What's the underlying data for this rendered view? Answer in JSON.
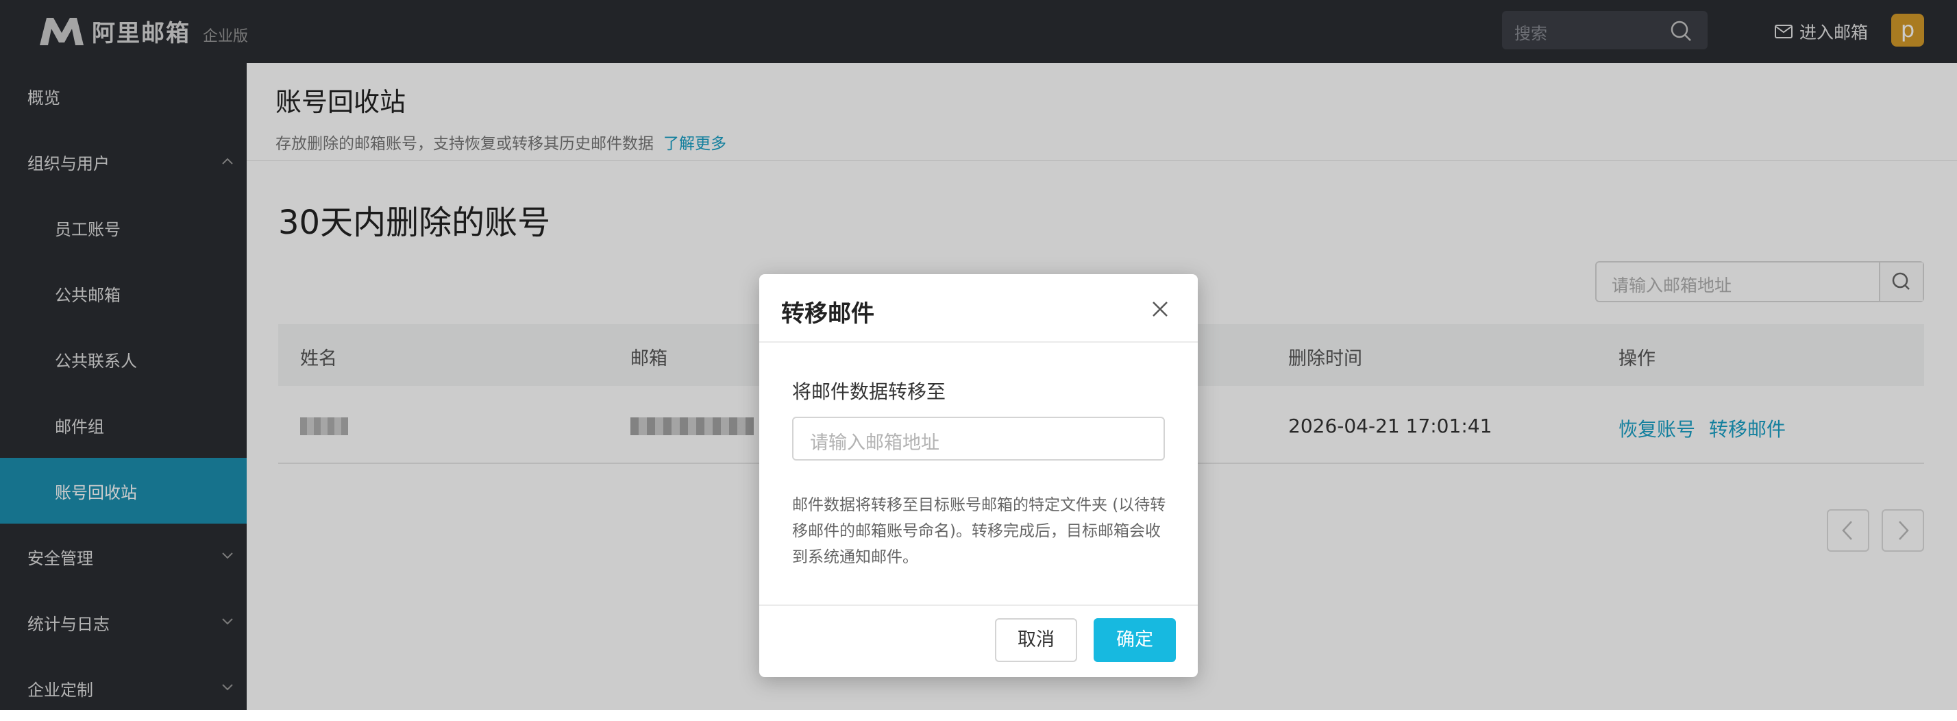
{
  "header": {
    "logo_text": "阿里邮箱",
    "logo_sub": "企业版",
    "search_placeholder": "搜索",
    "enter_mail_label": "进入邮箱",
    "avatar_letter": "p"
  },
  "sidebar": {
    "items": [
      {
        "label": "概览"
      },
      {
        "label": "组织与用户"
      },
      {
        "label": "员工账号"
      },
      {
        "label": "公共邮箱"
      },
      {
        "label": "公共联系人"
      },
      {
        "label": "邮件组"
      },
      {
        "label": "账号回收站"
      },
      {
        "label": "安全管理"
      },
      {
        "label": "统计与日志"
      },
      {
        "label": "企业定制"
      }
    ]
  },
  "page": {
    "title": "账号回收站",
    "description": "存放删除的邮箱账号，支持恢复或转移其历史邮件数据",
    "learn_more": "了解更多",
    "section_title": "30天内删除的账号",
    "search_placeholder": "请输入邮箱地址"
  },
  "table": {
    "headers": [
      "姓名",
      "邮箱",
      "删除时间",
      "操作"
    ],
    "rows": [
      {
        "delete_time": "2026-04-21 17:01:41",
        "restore": "恢复账号",
        "transfer": "转移邮件"
      }
    ]
  },
  "dialog": {
    "title": "转移邮件",
    "field_label": "将邮件数据转移至",
    "input_placeholder": "请输入邮箱地址",
    "description": "邮件数据将转移至目标账号邮箱的特定文件夹 (以待转移邮件的邮箱账号命名)。转移完成后，目标邮箱会收到系统通知邮件。",
    "cancel_label": "取消",
    "ok_label": "确定"
  },
  "colors": {
    "accent": "#17b9e0",
    "link": "#1aa0c6",
    "sidebar_active": "#1c8fb0",
    "topbar": "#2b2d33"
  }
}
